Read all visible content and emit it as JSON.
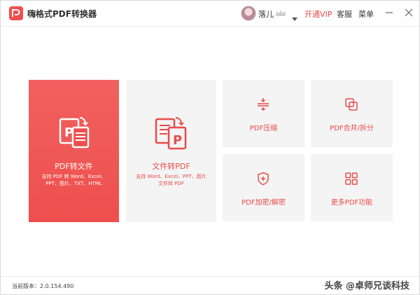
{
  "app": {
    "title": "嗨格式PDF转换器",
    "brand_color": "#f04e4e"
  },
  "header": {
    "username": "落儿",
    "vip_label": "开通VIP",
    "service_label": "客服",
    "menu_label": "菜单",
    "icons": [
      "crown-icon",
      "chevron-down-icon",
      "minimize-icon",
      "close-icon"
    ]
  },
  "tiles": {
    "pdf_to_file": {
      "title": "PDF转文件",
      "desc": "支持 PDF 转 Word、Excel、PPT、图片、TXT、HTML"
    },
    "file_to_pdf": {
      "title": "文件转PDF",
      "desc": "支持 Word、Excel、PPT、图片文件转 PDF"
    },
    "compress": {
      "title": "PDF压缩"
    },
    "merge_split": {
      "title": "PDF合并/拆分"
    },
    "encrypt": {
      "title": "PDF加密/解密"
    },
    "more": {
      "title": "更多PDF功能"
    }
  },
  "footer": {
    "version": "当前版本：2.0.154.490",
    "watermark": "头条 @卓师兄谈科技"
  }
}
